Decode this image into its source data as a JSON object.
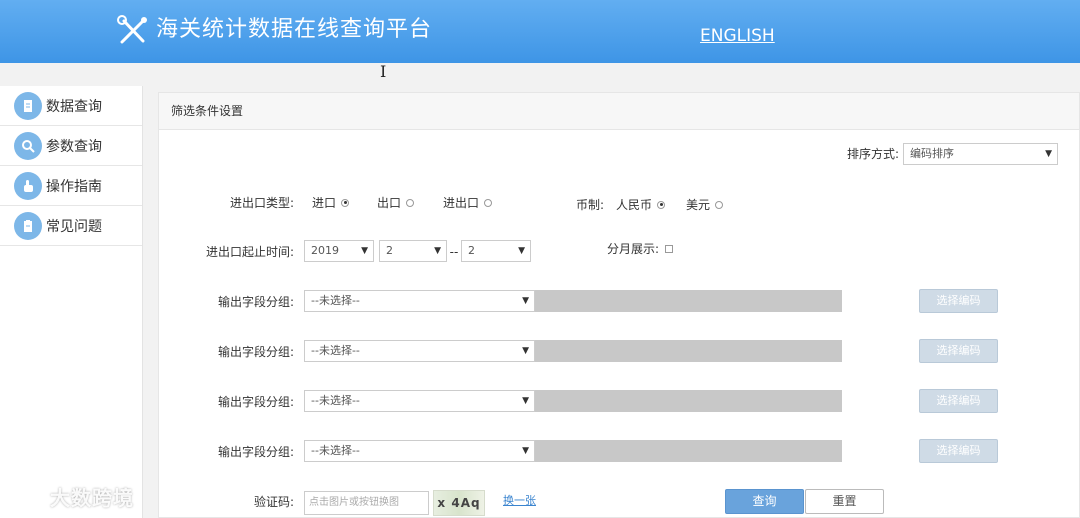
{
  "header": {
    "title": "海关统计数据在线查询平台",
    "lang_link": "ENGLISH"
  },
  "sidebar": {
    "items": [
      {
        "label": "数据查询",
        "icon": "document-icon"
      },
      {
        "label": "参数查询",
        "icon": "magnifier-icon"
      },
      {
        "label": "操作指南",
        "icon": "hand-pointer-icon"
      },
      {
        "label": "常见问题",
        "icon": "clipboard-icon"
      }
    ]
  },
  "panel": {
    "title": "筛选条件设置",
    "sort": {
      "label": "排序方式:",
      "value": "编码排序"
    },
    "trade_type": {
      "label": "进出口类型:",
      "options": [
        "进口",
        "出口",
        "进出口"
      ],
      "selected": "进口"
    },
    "currency": {
      "label": "币制:",
      "options": [
        "人民币",
        "美元"
      ],
      "selected": "人民币"
    },
    "period": {
      "label": "进出口起止时间:",
      "year": "2019",
      "start_month": "2",
      "separator": "--",
      "end_month": "2"
    },
    "monthly": {
      "label": "分月展示:",
      "checked": false
    },
    "field_groups": [
      {
        "label": "输出字段分组:",
        "value": "--未选择--",
        "button": "选择编码"
      },
      {
        "label": "输出字段分组:",
        "value": "--未选择--",
        "button": "选择编码"
      },
      {
        "label": "输出字段分组:",
        "value": "--未选择--",
        "button": "选择编码"
      },
      {
        "label": "输出字段分组:",
        "value": "--未选择--",
        "button": "选择编码"
      }
    ],
    "captcha": {
      "label": "验证码:",
      "placeholder": "点击图片或按钮换图",
      "image_text": "x 4Aq",
      "refresh": "换一张"
    },
    "buttons": {
      "query": "查询",
      "reset": "重置"
    }
  },
  "watermark": "大数跨境",
  "colors": {
    "header": "#4a9eea",
    "primary_button": "#69a3dc",
    "disabled_button": "#cfdbe6"
  }
}
